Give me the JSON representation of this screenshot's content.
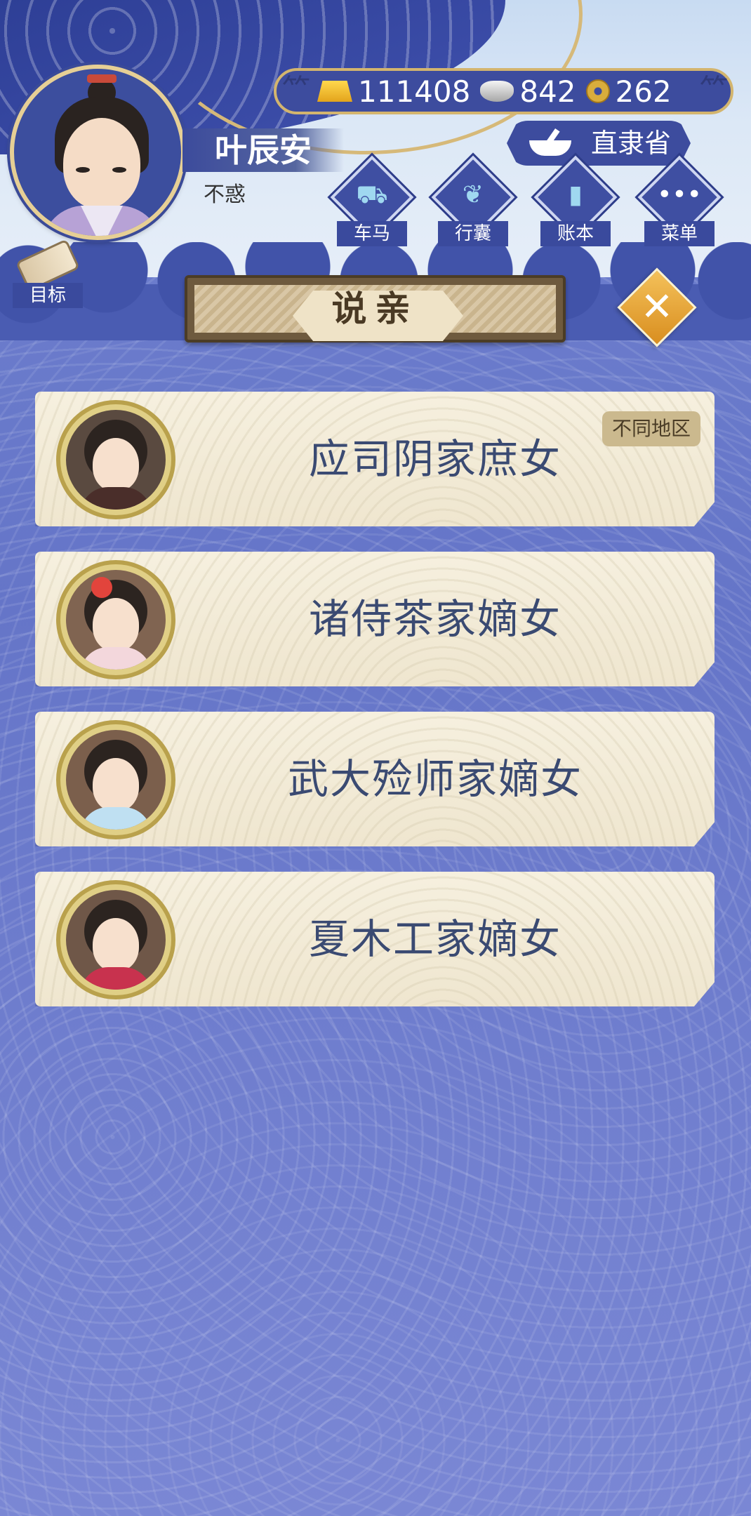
{
  "player": {
    "name": "叶辰安",
    "rank": "不惑"
  },
  "currency": {
    "gold": "111408",
    "silver": "842",
    "coins": "262"
  },
  "province": "直隶省",
  "menu": [
    {
      "label": "车马",
      "icon": "carriage-icon"
    },
    {
      "label": "行囊",
      "icon": "bag-icon"
    },
    {
      "label": "账本",
      "icon": "ledger-icon"
    },
    {
      "label": "菜单",
      "icon": "menu-dots-icon"
    }
  ],
  "goal_label": "目标",
  "title": "说亲",
  "cards": [
    {
      "name": "应司阴家庶女",
      "tag": "不同地区"
    },
    {
      "name": "诸侍茶家嫡女"
    },
    {
      "name": "武大殓师家嫡女"
    },
    {
      "name": "夏木工家嫡女"
    }
  ]
}
